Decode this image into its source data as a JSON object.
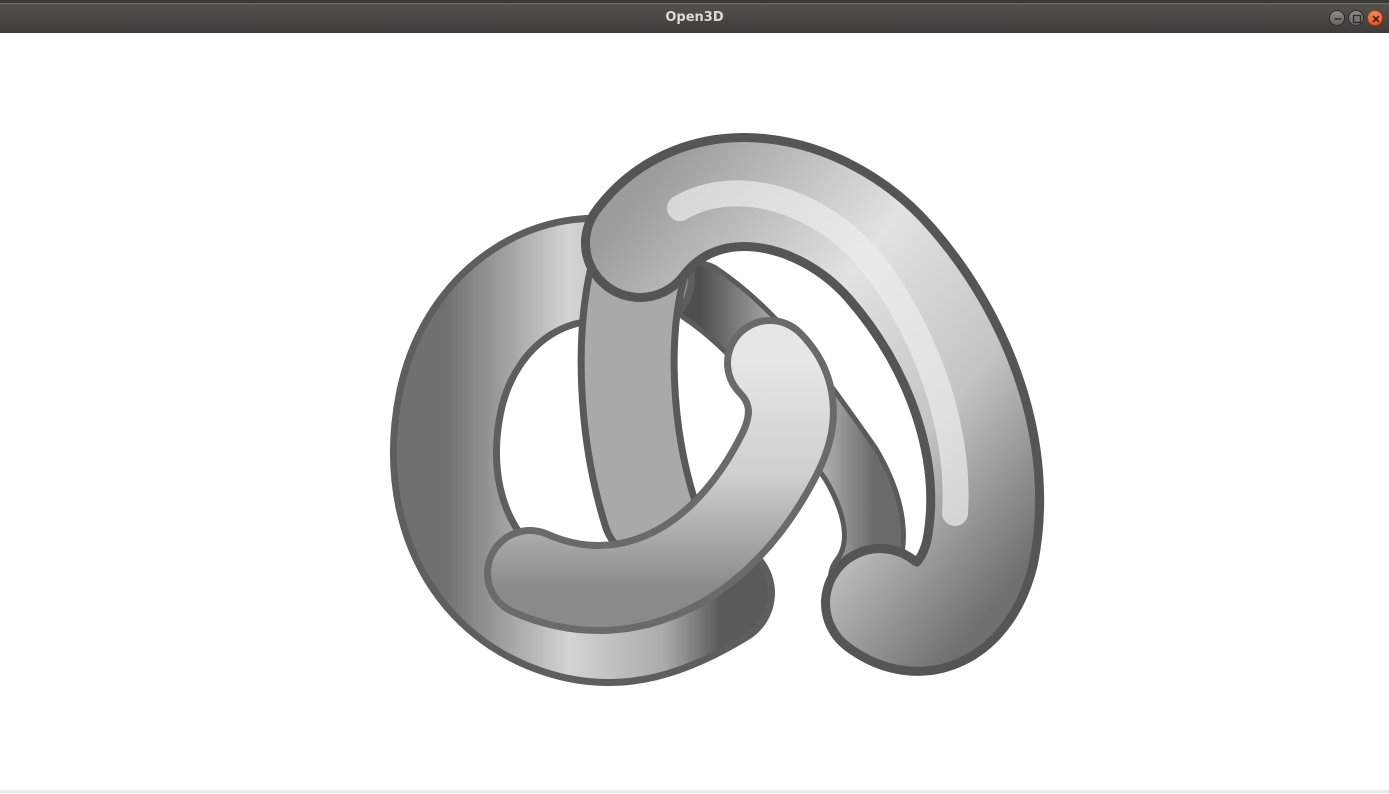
{
  "window": {
    "title": "Open3D",
    "controls": [
      {
        "name": "minimize",
        "icon": "minimize-icon"
      },
      {
        "name": "maximize",
        "icon": "maximize-icon"
      },
      {
        "name": "close",
        "icon": "close-icon"
      }
    ]
  },
  "scene": {
    "object": "trefoil-knot-mesh",
    "background": "#ffffff",
    "mesh_color": "#b8b8b8"
  }
}
